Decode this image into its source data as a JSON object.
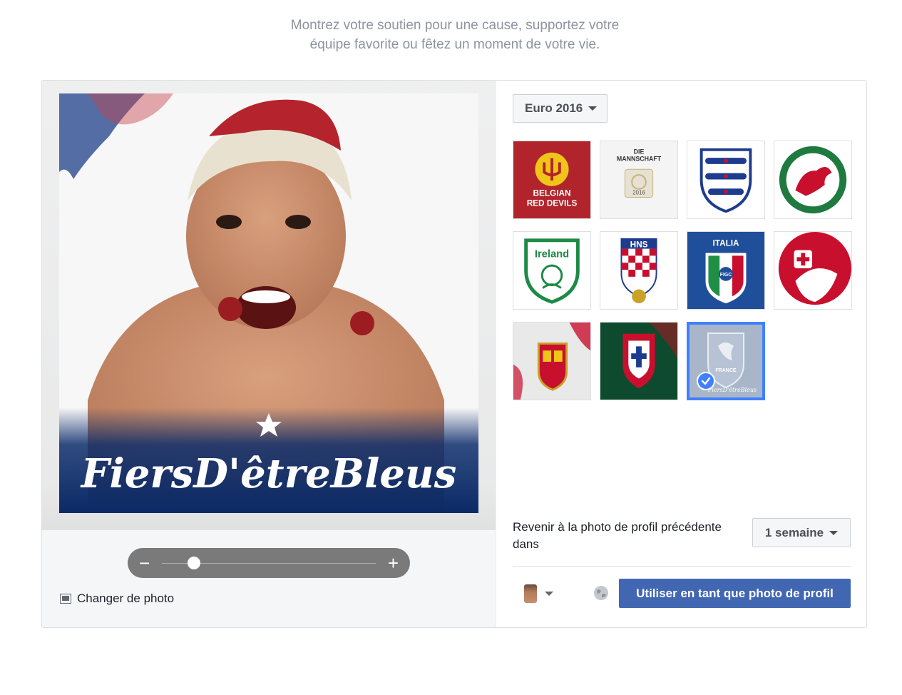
{
  "intro": {
    "line1": "Montrez votre soutien pour une cause, supportez votre",
    "line2": "équipe favorite ou fêtez un moment de votre vie."
  },
  "preview": {
    "frame_text": "FiersD'êtreBleus",
    "colors": {
      "frame_blue": "#0d2d6b",
      "frame_red": "#c81e2b"
    }
  },
  "zoom": {
    "minus_label": "−",
    "plus_label": "+",
    "level": 0.15
  },
  "change_photo": {
    "label": "Changer de photo",
    "icon": "photo-icon"
  },
  "frames": {
    "category": "Euro 2016",
    "tiles": [
      {
        "name": "belgium",
        "lines": [
          "BELGIAN",
          "RED DEVILS"
        ],
        "selected": false
      },
      {
        "name": "germany",
        "lines": [
          "DIE",
          "MANNSCHAFT",
          "2016"
        ],
        "selected": false
      },
      {
        "name": "england",
        "lines": [],
        "selected": false
      },
      {
        "name": "wales",
        "lines": [],
        "selected": false
      },
      {
        "name": "ireland",
        "lines": [
          "Ireland"
        ],
        "selected": false
      },
      {
        "name": "croatia",
        "lines": [
          "HNS"
        ],
        "selected": false
      },
      {
        "name": "italy",
        "lines": [
          "ITALIA",
          "FIGC"
        ],
        "selected": false
      },
      {
        "name": "switzerland",
        "lines": [],
        "selected": false
      },
      {
        "name": "spain",
        "lines": [],
        "selected": false
      },
      {
        "name": "portugal",
        "lines": [],
        "selected": false
      },
      {
        "name": "france",
        "lines": [
          "FRANCE",
          "FiersD'êtreBleus"
        ],
        "selected": true
      }
    ]
  },
  "revert": {
    "label": "Revenir à la photo de profil précédente dans",
    "duration": "1 semaine"
  },
  "footer": {
    "audience_icon": "globe-icon",
    "use_button": "Utiliser en tant que photo de profil"
  },
  "colors": {
    "accent": "#4267b2",
    "selected_border": "#4080ff"
  }
}
